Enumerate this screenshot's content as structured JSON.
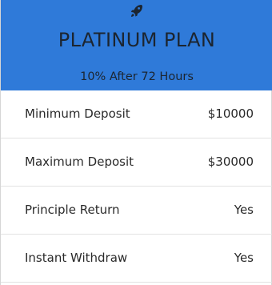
{
  "plan": {
    "icon": "rocket-icon",
    "title": "PLATINUM PLAN",
    "subtitle": "10% After 72 Hours",
    "header_color": "#2f7ad9"
  },
  "details": [
    {
      "label": "Minimum Deposit",
      "value": "$10000"
    },
    {
      "label": "Maximum Deposit",
      "value": "$30000"
    },
    {
      "label": "Principle Return",
      "value": "Yes"
    },
    {
      "label": "Instant Withdraw",
      "value": "Yes"
    }
  ]
}
